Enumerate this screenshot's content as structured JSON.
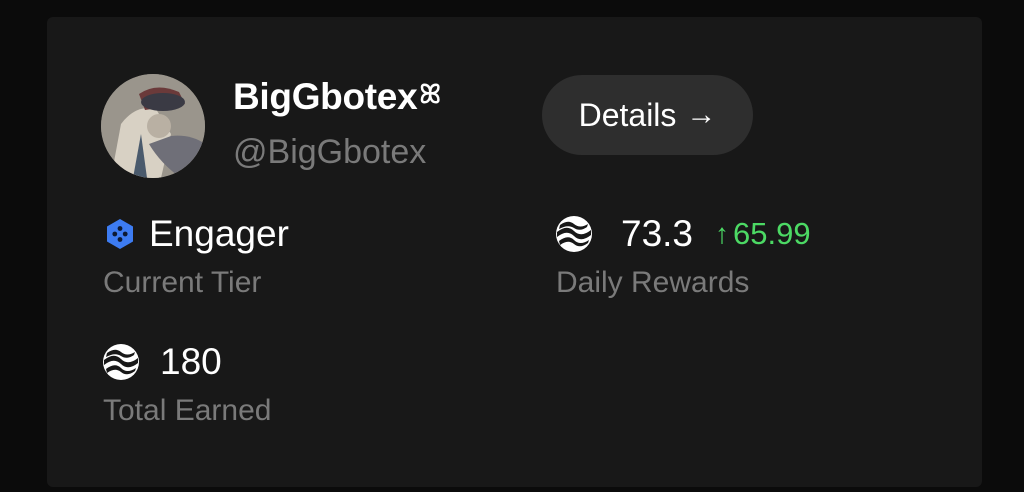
{
  "profile": {
    "display_name": "BigGbotex",
    "name_glyph": "ꕤ",
    "handle": "@BigGbotex"
  },
  "details_button": {
    "label": "Details",
    "arrow": "→"
  },
  "tier": {
    "value": "Engager",
    "label": "Current Tier",
    "icon": "tier-hexagon-icon",
    "icon_color": "#3d7cf2"
  },
  "daily_rewards": {
    "value": "73.3",
    "change_arrow": "↑",
    "change": "65.99",
    "change_color": "#4cd964",
    "label": "Daily Rewards",
    "icon": "token-logo-icon"
  },
  "total_earned": {
    "value": "180",
    "label": "Total Earned",
    "icon": "token-logo-icon"
  }
}
